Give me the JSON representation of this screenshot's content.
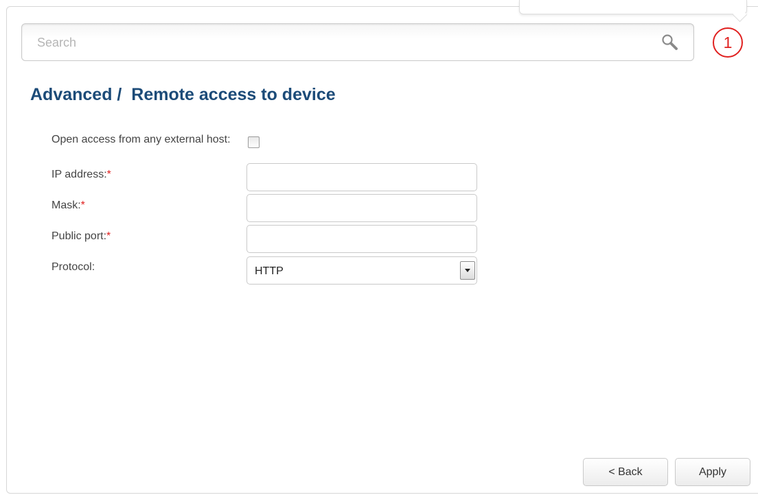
{
  "search": {
    "placeholder": "Search",
    "value": ""
  },
  "notifications": {
    "count": "1"
  },
  "page": {
    "title": "Advanced /  Remote access to device"
  },
  "form": {
    "open_access_label": "Open access from any external host:",
    "open_access_checked": false,
    "ip_label": "IP address:",
    "ip_value": "",
    "mask_label": "Mask:",
    "mask_value": "",
    "port_label": "Public port:",
    "port_value": "",
    "protocol_label": "Protocol:",
    "protocol_value": "HTTP",
    "required_marker": "*"
  },
  "buttons": {
    "back_label": "< Back",
    "apply_label": "Apply"
  },
  "colors": {
    "title": "#1c4b78",
    "required": "#e0201f",
    "badge": "#e0201f"
  },
  "icons": {
    "search": "search-icon",
    "dropdown": "chevron-down-icon"
  }
}
